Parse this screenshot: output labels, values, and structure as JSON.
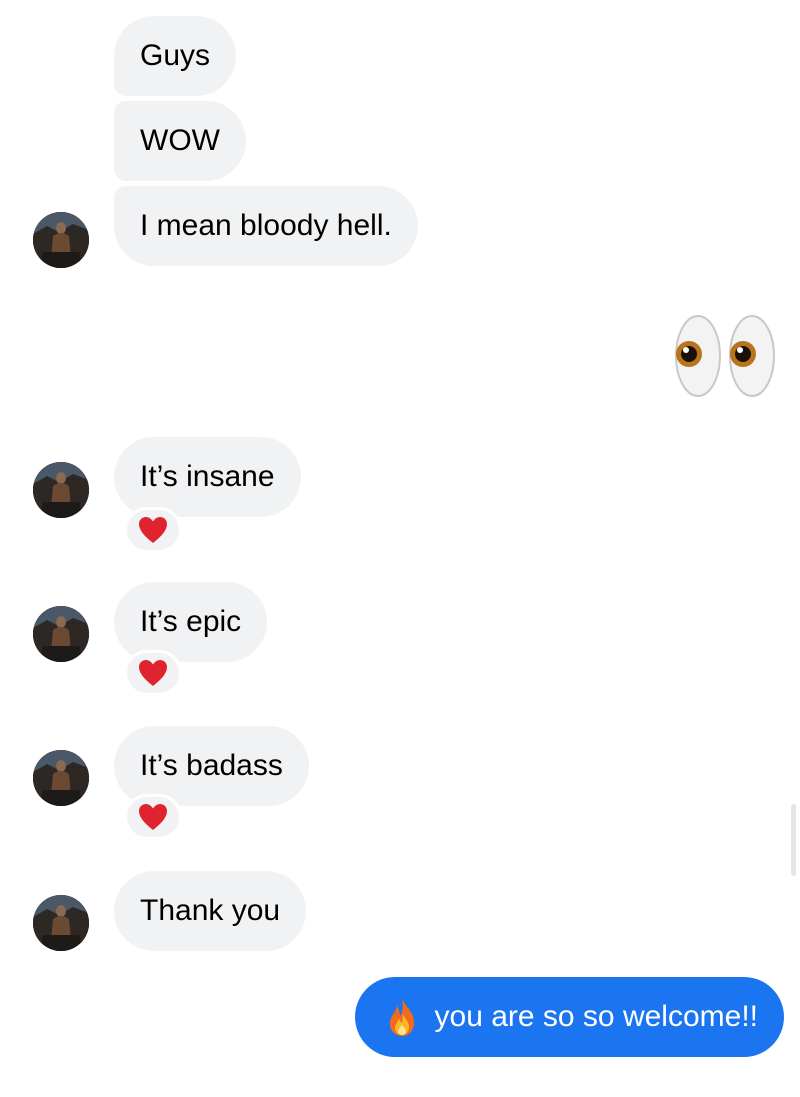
{
  "messages": {
    "m1": "Guys",
    "m2": "WOW",
    "m3": "I mean bloody hell.",
    "m4": "It’s insane",
    "m5": "It’s epic",
    "m6": "It’s badass",
    "m7": "Thank you",
    "sent": "you are so so welcome!!"
  },
  "icons": {
    "reaction": "red-heart-icon",
    "sent_emoji": "eyes-icon",
    "sent_prefix": "fire-icon",
    "avatar": "contact-avatar"
  },
  "colors": {
    "received_bubble": "#f1f2f4",
    "sent_bubble": "#1b74f0",
    "heart": "#e0242f"
  }
}
